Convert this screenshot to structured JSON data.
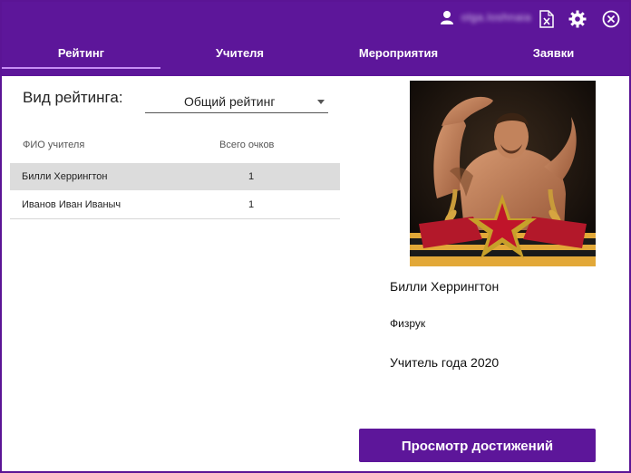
{
  "header": {
    "user_name": "olga.loshnaia",
    "icons": [
      "user-icon",
      "excel-icon",
      "gear-icon",
      "close-icon"
    ]
  },
  "tabs": [
    {
      "label": "Рейтинг",
      "active": true
    },
    {
      "label": "Учителя",
      "active": false
    },
    {
      "label": "Мероприятия",
      "active": false
    },
    {
      "label": "Заявки",
      "active": false
    }
  ],
  "rating": {
    "type_label": "Вид рейтинга:",
    "selected_type": "Общий рейтинг",
    "columns": [
      "ФИО учителя",
      "Всего очков"
    ],
    "rows": [
      {
        "name": "Билли Херрингтон",
        "score": "1",
        "selected": true
      },
      {
        "name": "Иванов Иван Иваныч",
        "score": "1",
        "selected": false
      }
    ]
  },
  "teacher": {
    "name": "Билли Херрингтон",
    "subject": "Физрук",
    "award": "Учитель года 2020"
  },
  "actions": {
    "achievements_label": "Просмотр достижений"
  },
  "colors": {
    "brand": "#5d169a",
    "tab_indicator": "#c58df3",
    "selected_row": "#dcdcdc"
  }
}
